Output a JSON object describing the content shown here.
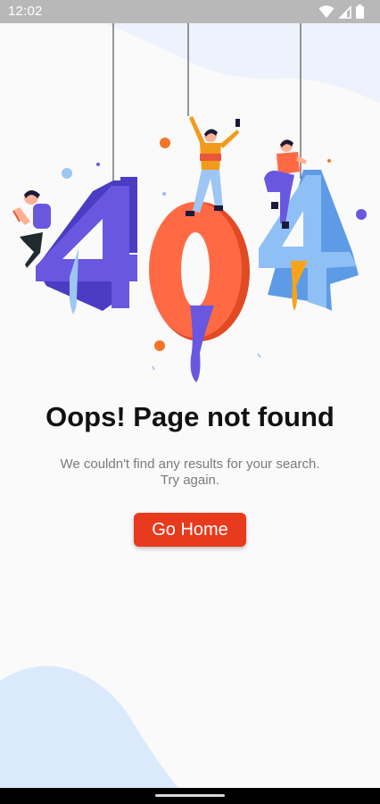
{
  "status_bar": {
    "time": "12:02",
    "icons": [
      "wifi-icon",
      "cell-signal-icon",
      "battery-icon"
    ]
  },
  "illustration": {
    "digits": [
      "4",
      "0",
      "4"
    ],
    "colors": {
      "first_four": "#6a57e0",
      "zero": "#ff6a45",
      "last_four": "#8ec0f5",
      "drip_purple": "#6a57e0",
      "drip_orange": "#f7a418",
      "drip_blue": "#8ec0f5"
    }
  },
  "content": {
    "title": "Oops! Page not found",
    "subtitle_line1": "We couldn't find any results for your search.",
    "subtitle_line2": "Try again.",
    "home_button": "Go Home"
  },
  "colors": {
    "accent": "#e83a1c",
    "background": "#fafafa",
    "blob": "#dbe9fc"
  }
}
